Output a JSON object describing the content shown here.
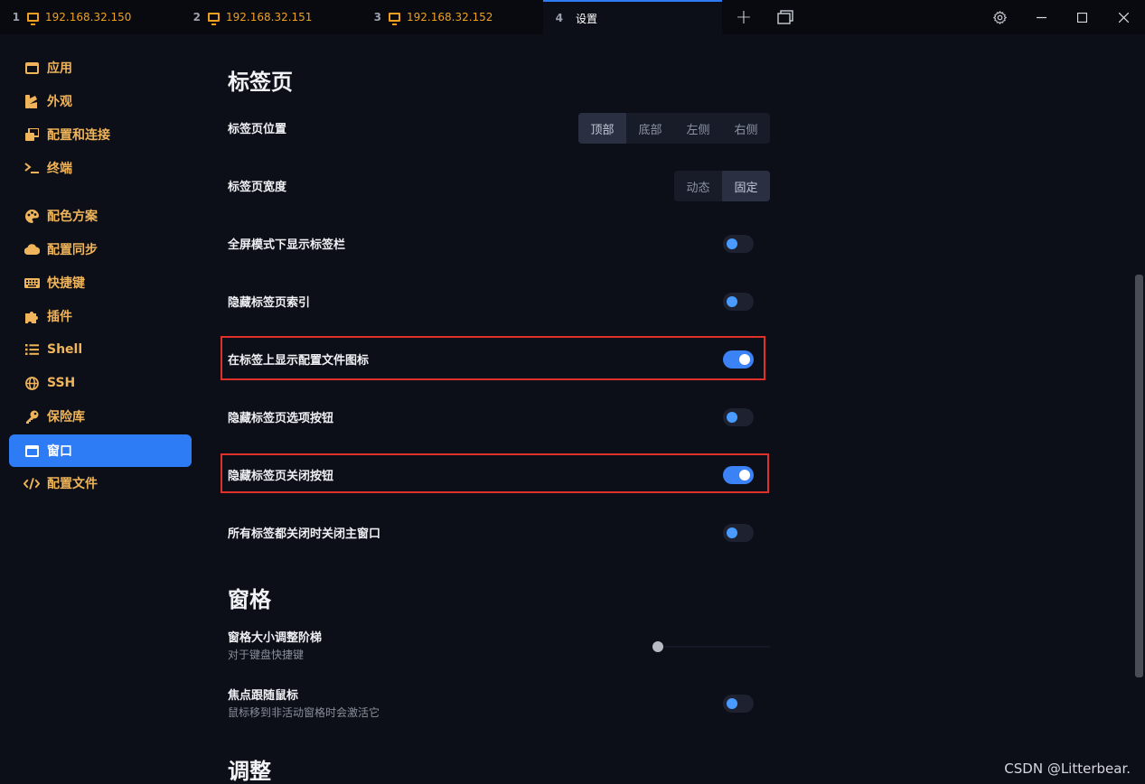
{
  "tabs": [
    {
      "num": "1",
      "label": "192.168.32.150"
    },
    {
      "num": "2",
      "label": "192.168.32.151"
    },
    {
      "num": "3",
      "label": "192.168.32.152"
    },
    {
      "num": "4",
      "label": "设置"
    }
  ],
  "sidebar": {
    "items": [
      {
        "label": "应用",
        "icon": "app-icon"
      },
      {
        "label": "外观",
        "icon": "appearance-icon"
      },
      {
        "label": "配置和连接",
        "icon": "profiles-icon"
      },
      {
        "label": "终端",
        "icon": "terminal-icon"
      },
      {
        "label": "配色方案",
        "icon": "palette-icon"
      },
      {
        "label": "配置同步",
        "icon": "cloud-icon"
      },
      {
        "label": "快捷键",
        "icon": "keyboard-icon"
      },
      {
        "label": "插件",
        "icon": "puzzle-icon"
      },
      {
        "label": "Shell",
        "icon": "list-icon"
      },
      {
        "label": "SSH",
        "icon": "globe-icon"
      },
      {
        "label": "保险库",
        "icon": "key-icon"
      },
      {
        "label": "窗口",
        "icon": "window-icon"
      },
      {
        "label": "配置文件",
        "icon": "code-icon"
      }
    ],
    "active": "窗口"
  },
  "sections": {
    "tabs_title": "标签页",
    "panes_title": "窗格",
    "adjust_title": "调整"
  },
  "settings": {
    "tab_position": {
      "label": "标签页位置",
      "options": [
        "顶部",
        "底部",
        "左侧",
        "右侧"
      ],
      "selected": "顶部"
    },
    "tab_width": {
      "label": "标签页宽度",
      "options": [
        "动态",
        "固定"
      ],
      "selected": "固定"
    },
    "fullscreen_tabbar": {
      "label": "全屏模式下显示标签栏",
      "on": false
    },
    "hide_tab_index": {
      "label": "隐藏标签页索引",
      "on": false
    },
    "show_profile_icon": {
      "label": "在标签上显示配置文件图标",
      "on": true
    },
    "hide_tab_options": {
      "label": "隐藏标签页选项按钮",
      "on": false
    },
    "hide_tab_close": {
      "label": "隐藏标签页关闭按钮",
      "on": true
    },
    "close_window_all_tabs": {
      "label": "所有标签都关闭时关闭主窗口",
      "on": false
    },
    "pane_resize_step": {
      "label": "窗格大小调整阶梯",
      "sub": "对于键盘快捷键",
      "value": 0.0
    },
    "focus_follows_mouse": {
      "label": "焦点跟随鼠标",
      "sub": "鼠标移到非活动窗格时会激活它",
      "on": false
    }
  },
  "watermark": "CSDN @Litterbear.",
  "colors": {
    "accent": "#2d7cf6",
    "tab_text": "#f0a020",
    "sidebar_text": "#f0b45a",
    "highlight": "#e0302a"
  }
}
